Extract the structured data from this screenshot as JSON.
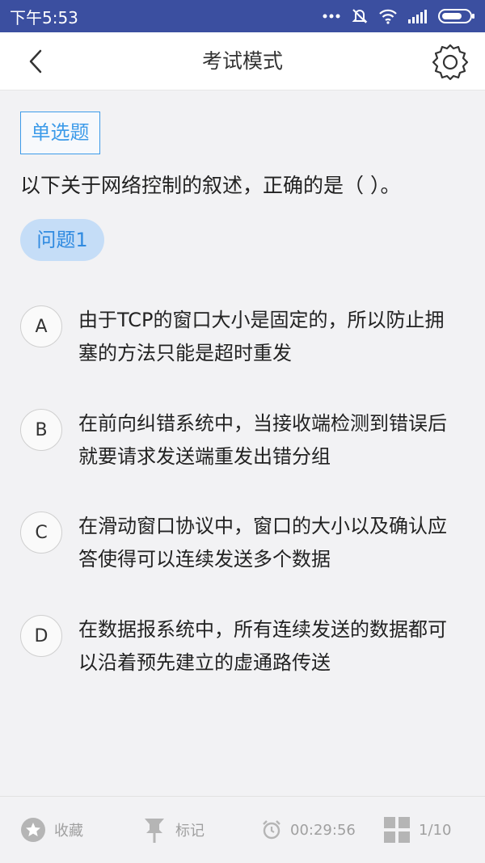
{
  "status_bar": {
    "time": "下午5:53"
  },
  "nav": {
    "title": "考试模式"
  },
  "question": {
    "type_label": "单选题",
    "text": "以下关于网络控制的叙述，正确的是（ ）。",
    "badge": "问题1",
    "options": [
      {
        "letter": "A",
        "text": "由于TCP的窗口大小是固定的，所以防止拥塞的方法只能是超时重发"
      },
      {
        "letter": "B",
        "text": "在前向纠错系统中，当接收端检测到错误后就要请求发送端重发出错分组"
      },
      {
        "letter": "C",
        "text": "在滑动窗口协议中，窗口的大小以及确认应答使得可以连续发送多个数据"
      },
      {
        "letter": "D",
        "text": "在数据报系统中，所有连续发送的数据都可以沿着预先建立的虚通路传送"
      }
    ]
  },
  "bottom_bar": {
    "favorite_label": "收藏",
    "mark_label": "标记",
    "timer": "00:29:56",
    "progress": "1/10"
  }
}
